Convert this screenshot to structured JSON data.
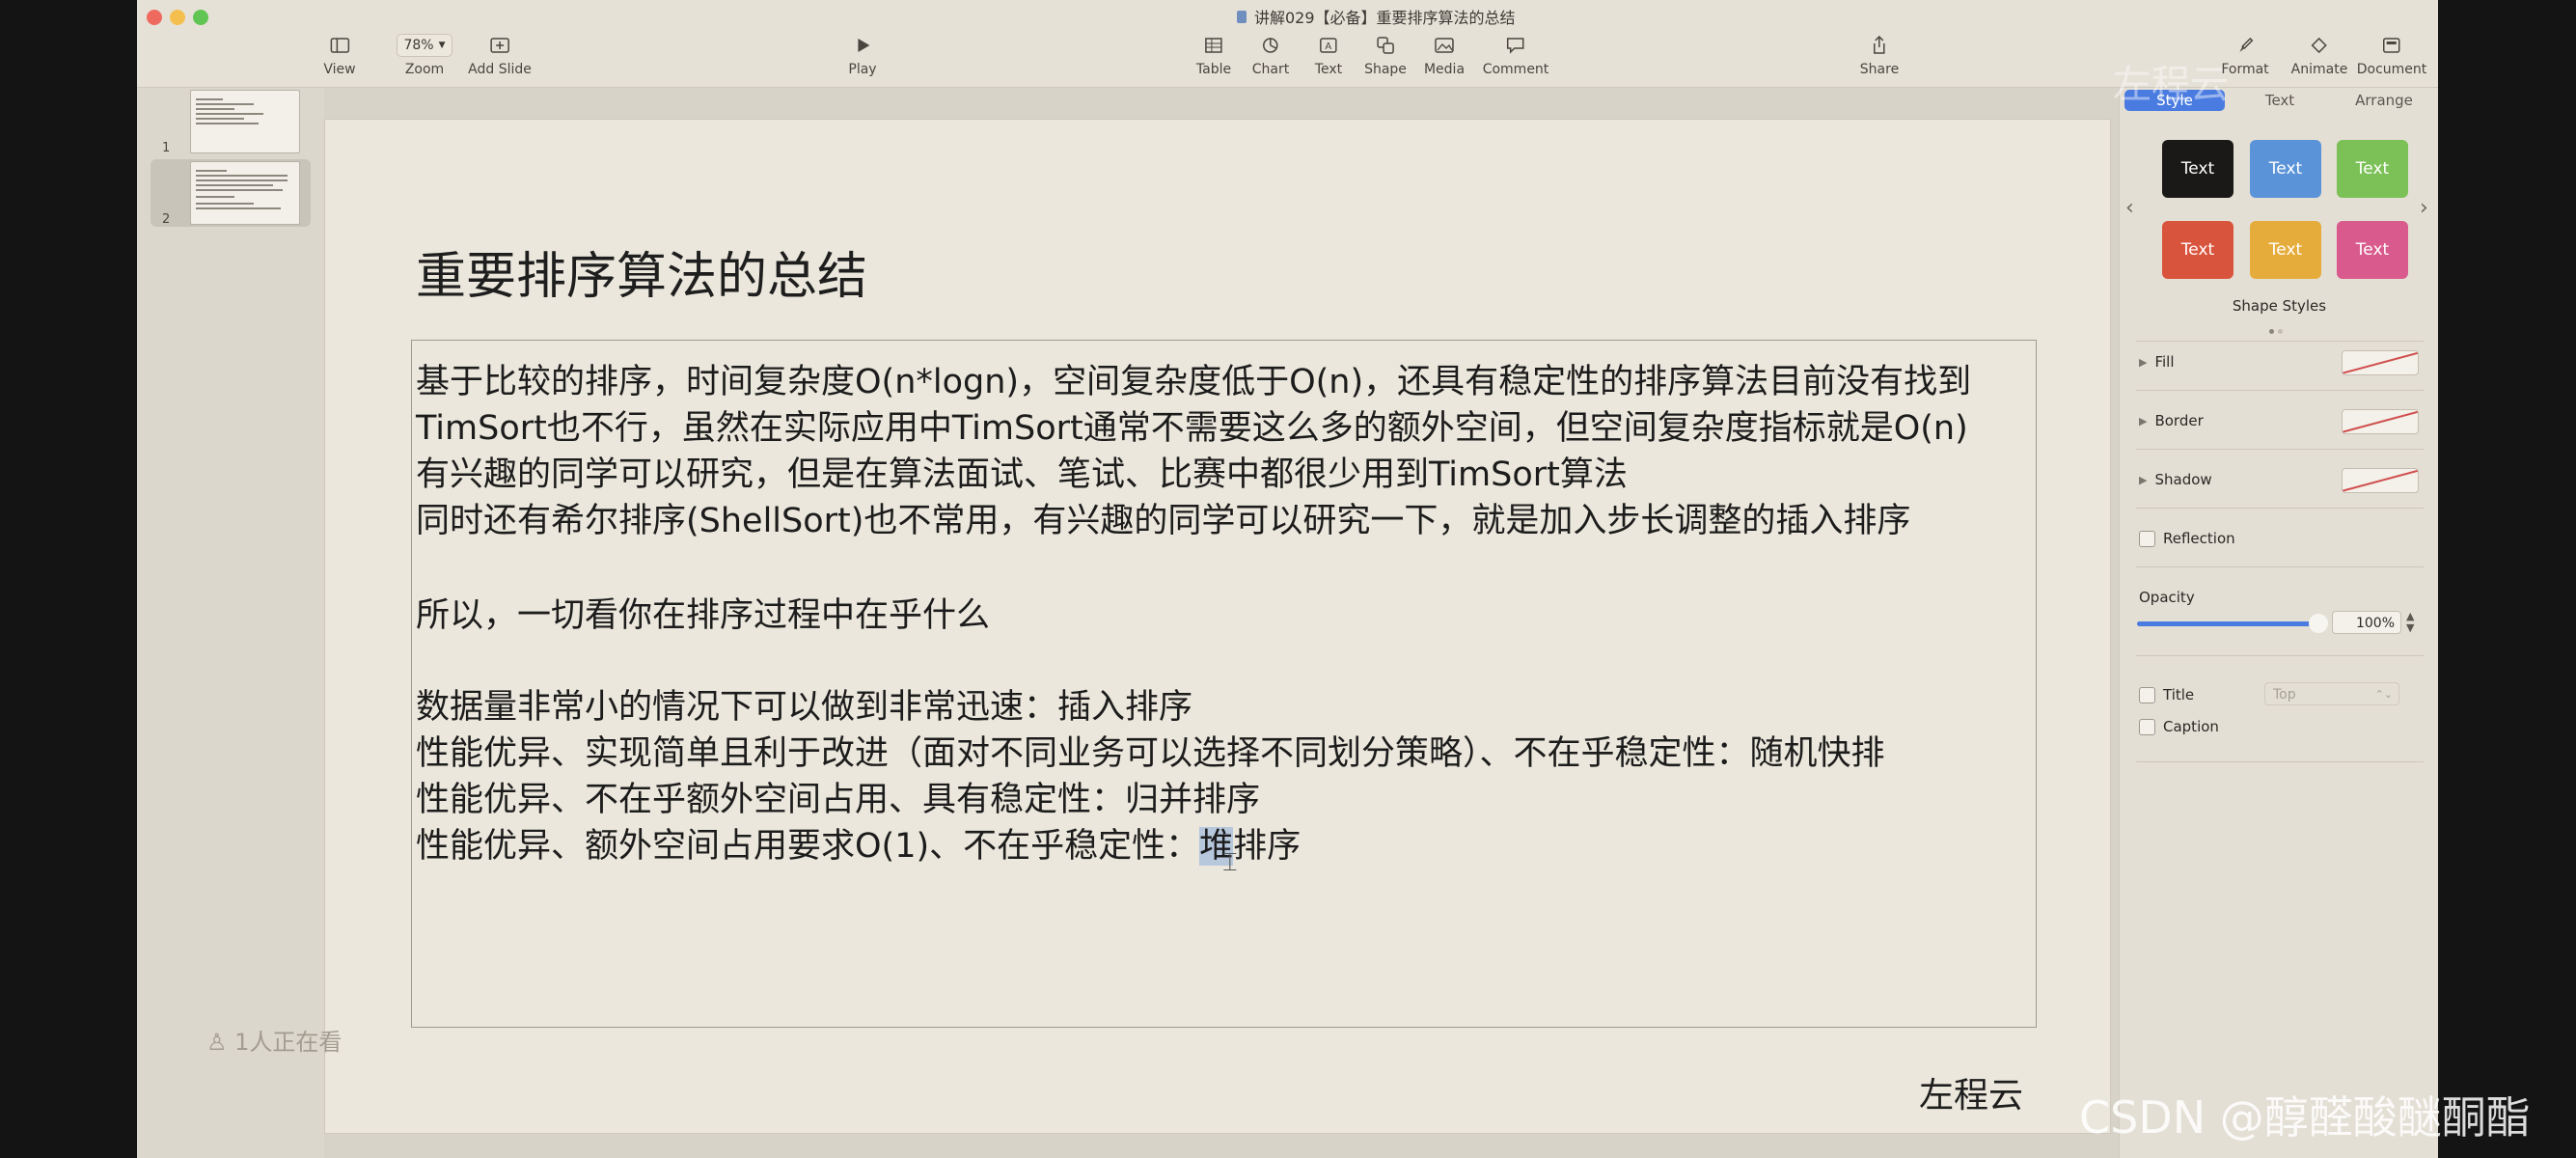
{
  "window": {
    "title": "讲解029【必备】重要排序算法的总结"
  },
  "toolbar": {
    "view": "View",
    "zoom_label": "Zoom",
    "zoom_value": "78%",
    "add_slide": "Add Slide",
    "play": "Play",
    "table": "Table",
    "chart": "Chart",
    "text": "Text",
    "shape": "Shape",
    "media": "Media",
    "comment": "Comment",
    "share": "Share",
    "format": "Format",
    "animate": "Animate",
    "document": "Document"
  },
  "navigator": {
    "slides": [
      {
        "number": "1"
      },
      {
        "number": "2"
      }
    ]
  },
  "slide": {
    "title": "重要排序算法的总结",
    "lines": [
      "基于比较的排序，时间复杂度O(n*logn)，空间复杂度低于O(n)，还具有稳定性的排序算法目前没有找到",
      "TimSort也不行，虽然在实际应用中TimSort通常不需要这么多的额外空间，但空间复杂度指标就是O(n)",
      "有兴趣的同学可以研究，但是在算法面试、笔试、比赛中都很少用到TimSort算法",
      "同时还有希尔排序(ShellSort)也不常用，有兴趣的同学可以研究一下，就是加入步长调整的插入排序",
      "所以，一切看你在排序过程中在乎什么",
      "数据量非常小的情况下可以做到非常迅速：插入排序",
      "性能优异、实现简单且利于改进（面对不同业务可以选择不同划分策略）、不在乎稳定性：随机快排",
      "性能优异、不在乎额外空间占用、具有稳定性：归并排序"
    ],
    "last_line_prefix": "性能优异、额外空间占用要求O(1)、不在乎稳定性：",
    "last_line_selected": "堆",
    "last_line_suffix": "排序",
    "footer": "左程云",
    "viewers": "1人正在看"
  },
  "inspector": {
    "tabs": [
      "Style",
      "Text",
      "Arrange"
    ],
    "swatch_label": "Text",
    "shape_styles_label": "Shape Styles",
    "fill": "Fill",
    "border": "Border",
    "shadow": "Shadow",
    "reflection": "Reflection",
    "opacity_label": "Opacity",
    "opacity_value": "100%",
    "opacity_fraction": 1.0,
    "title": "Title",
    "title_position": "Top",
    "caption": "Caption",
    "swatch_colors": [
      "#1b1917",
      "#5b93d9",
      "#7cc157",
      "#d9543c",
      "#e6ac3b",
      "#d95a8c"
    ]
  },
  "watermarks": {
    "top": "左程云",
    "bottom": "CSDN @醇醛酸醚酮酯"
  }
}
